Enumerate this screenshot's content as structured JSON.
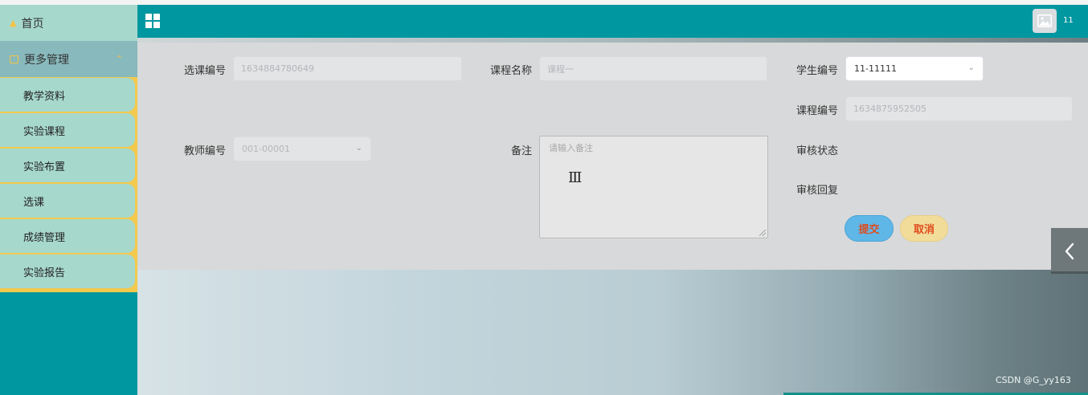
{
  "sidebar": {
    "home_label": "首页",
    "group_label": "更多管理",
    "items": [
      {
        "label": "教学资料"
      },
      {
        "label": "实验课程"
      },
      {
        "label": "实验布置"
      },
      {
        "label": "选课"
      },
      {
        "label": "成绩管理"
      },
      {
        "label": "实验报告"
      }
    ]
  },
  "header": {
    "user_name": "11"
  },
  "form": {
    "selection_id": {
      "label": "选课编号",
      "value": "1634884780649"
    },
    "course_name": {
      "label": "课程名称",
      "value": "课程一"
    },
    "student_id": {
      "label": "学生编号",
      "value": "11-11111"
    },
    "course_id": {
      "label": "课程编号",
      "value": "1634875952505"
    },
    "teacher_id": {
      "label": "教师编号",
      "value": "001-00001"
    },
    "remark": {
      "label": "备注",
      "placeholder": "请输入备注"
    },
    "review_status": {
      "label": "审核状态"
    },
    "review_reply": {
      "label": "审核回复"
    },
    "submit_label": "提交",
    "cancel_label": "取消"
  },
  "watermark": "CSDN @G_yy163",
  "colors": {
    "teal": "#0097a0",
    "menu_bg": "#a7d8cc",
    "menu_border": "#f2c94c",
    "submit_bg": "#5fb7e8",
    "cancel_bg": "#f1dc9a",
    "button_text": "#e04b1c"
  }
}
